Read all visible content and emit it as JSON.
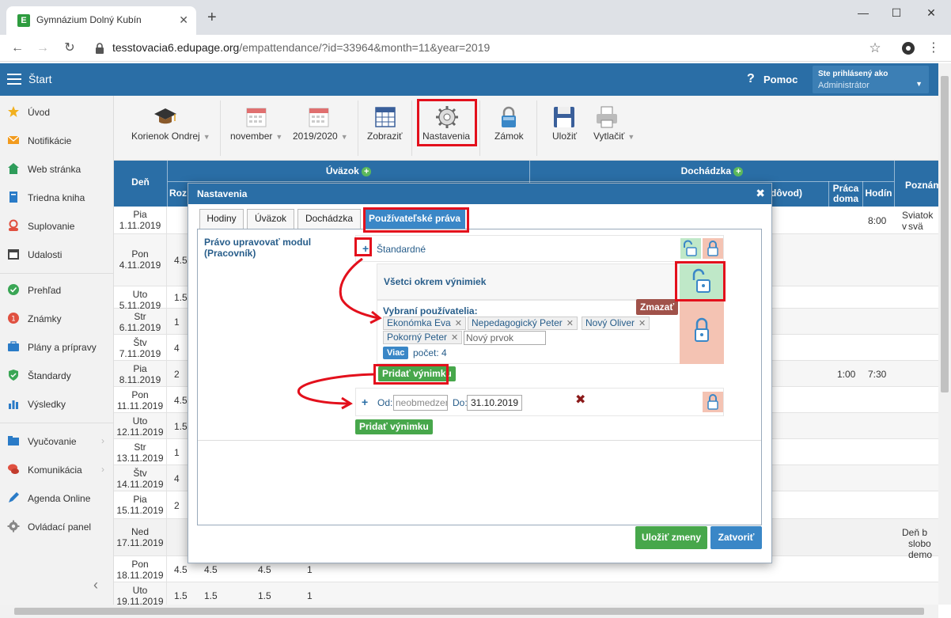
{
  "browser": {
    "tab_title": "Gymnázium Dolný Kubín",
    "tab_favicon": "E",
    "url_host": "tesstovacia6.edupage.org",
    "url_path": "/empattendance/?id=33964&month=11&year=2019"
  },
  "appbar": {
    "start_label": "Štart",
    "help_label": "Pomoc",
    "user_logged_label": "Ste prihlásený ako",
    "user_name": "Administrátor"
  },
  "sidebar": {
    "items": [
      {
        "label": "Úvod",
        "icon": "star-icon",
        "color": "#f2b01e"
      },
      {
        "label": "Notifikácie",
        "icon": "envelope-icon",
        "color": "#f29b1e"
      },
      {
        "label": "Web stránka",
        "icon": "home-icon",
        "color": "#2e9c5a"
      },
      {
        "label": "Triedna kniha",
        "icon": "book-icon",
        "color": "#2a7bc7"
      },
      {
        "label": "Suplovanie",
        "icon": "person-icon",
        "color": "#e05040"
      },
      {
        "label": "Udalosti",
        "icon": "calendar-icon",
        "color": "#444444"
      },
      {
        "label": "Prehľad",
        "icon": "check-circle-icon",
        "color": "#3aa655"
      },
      {
        "label": "Známky",
        "icon": "grade-icon",
        "color": "#e05040"
      },
      {
        "label": "Plány a prípravy",
        "icon": "briefcase-icon",
        "color": "#2a7bc7"
      },
      {
        "label": "Štandardy",
        "icon": "shield-icon",
        "color": "#3aa655"
      },
      {
        "label": "Výsledky",
        "icon": "bar-chart-icon",
        "color": "#2a7bc7"
      },
      {
        "label": "Vyučovanie",
        "icon": "folder-icon",
        "color": "#2a7bc7"
      },
      {
        "label": "Komunikácia",
        "icon": "chat-icon",
        "color": "#e05040"
      },
      {
        "label": "Agenda Online",
        "icon": "pen-icon",
        "color": "#2a7bc7"
      },
      {
        "label": "Ovládací panel",
        "icon": "gear-icon",
        "color": "#888888"
      }
    ]
  },
  "toolbar": {
    "employee": "Korienok Ondrej",
    "month": "november",
    "year": "2019/2020",
    "show": "Zobraziť",
    "settings": "Nastavenia",
    "lock": "Zámok",
    "save": "Uložiť",
    "print": "Vytlačiť"
  },
  "table": {
    "col_day": "Deň",
    "col_uvazok": "Úväzok",
    "col_dochadzka": "Dochádzka",
    "col_roz": "Roz",
    "col_dovod": "dôvod)",
    "col_praca_1": "Práca",
    "col_praca_2": "doma",
    "col_hodin": "Hodín",
    "col_poznamka": "Poznám",
    "rows": [
      {
        "d1": "Pia",
        "d2": "1.11.2019",
        "c1": "",
        "hodin": "8:00",
        "note": "Sviatok v",
        "note2": "svä"
      },
      {
        "d1": "Pon",
        "d2": "4.11.2019",
        "c1": "4.5"
      },
      {
        "d1": "Uto",
        "d2": "5.11.2019",
        "c1": "1.5"
      },
      {
        "d1": "Str",
        "d2": "6.11.2019",
        "c1": "1"
      },
      {
        "d1": "Štv",
        "d2": "7.11.2019",
        "c1": "4"
      },
      {
        "d1": "Pia",
        "d2": "8.11.2019",
        "c1": "2",
        "praca": "1:00",
        "hodin": "7:30"
      },
      {
        "d1": "Pon",
        "d2": "11.11.2019",
        "c1": "4.5"
      },
      {
        "d1": "Uto",
        "d2": "12.11.2019",
        "c1": "1.5"
      },
      {
        "d1": "Str",
        "d2": "13.11.2019",
        "c1": "1"
      },
      {
        "d1": "Štv",
        "d2": "14.11.2019",
        "c1": "4"
      },
      {
        "d1": "Pia",
        "d2": "15.11.2019",
        "c1": "2"
      },
      {
        "d1": "Ned",
        "d2": "17.11.2019",
        "c1": "",
        "note": "Deň b",
        "note2": "slobo",
        "note3": "demo"
      },
      {
        "d1": "Pon",
        "d2": "18.11.2019",
        "c1": "4.5",
        "c2": "4.5",
        "c3": "4.5",
        "c4": "1"
      },
      {
        "d1": "Uto",
        "d2": "19.11.2019",
        "c1": "1.5",
        "c2": "1.5",
        "c3": "1.5",
        "c4": "1"
      }
    ]
  },
  "dialog": {
    "title": "Nastavenia",
    "tabs": [
      "Hodiny",
      "Úväzok",
      "Dochádzka",
      "Používateľské práva"
    ],
    "perm_label": "Právo upravovať modul (Pracovník)",
    "standard_label": "Štandardné",
    "all_except_label": "Všetci okrem výnimiek",
    "selected_users_label": "Vybraní používatelia:",
    "chips": [
      "Ekonómka Eva",
      "Nepedagogický Peter",
      "Nový Oliver",
      "Pokorný Peter"
    ],
    "new_item_placeholder": "Nový prvok",
    "more_label": "Viac",
    "count_label": "počet: 4",
    "delete_label": "Zmazať",
    "add_exception_label": "Pridať výnimku",
    "od_label": "Od:",
    "od_placeholder": "neobmedzene",
    "do_label": "Do:",
    "do_value": "31.10.2019",
    "add_exception_label_2": "Pridať výnimku",
    "save_changes": "Uložiť zmeny",
    "close": "Zatvoriť"
  },
  "colors": {
    "header_blue": "#2a6ea6",
    "highlight_red": "#e3101c",
    "unlock_green": "#bfe8c8",
    "lock_red": "#f4c3b3"
  }
}
